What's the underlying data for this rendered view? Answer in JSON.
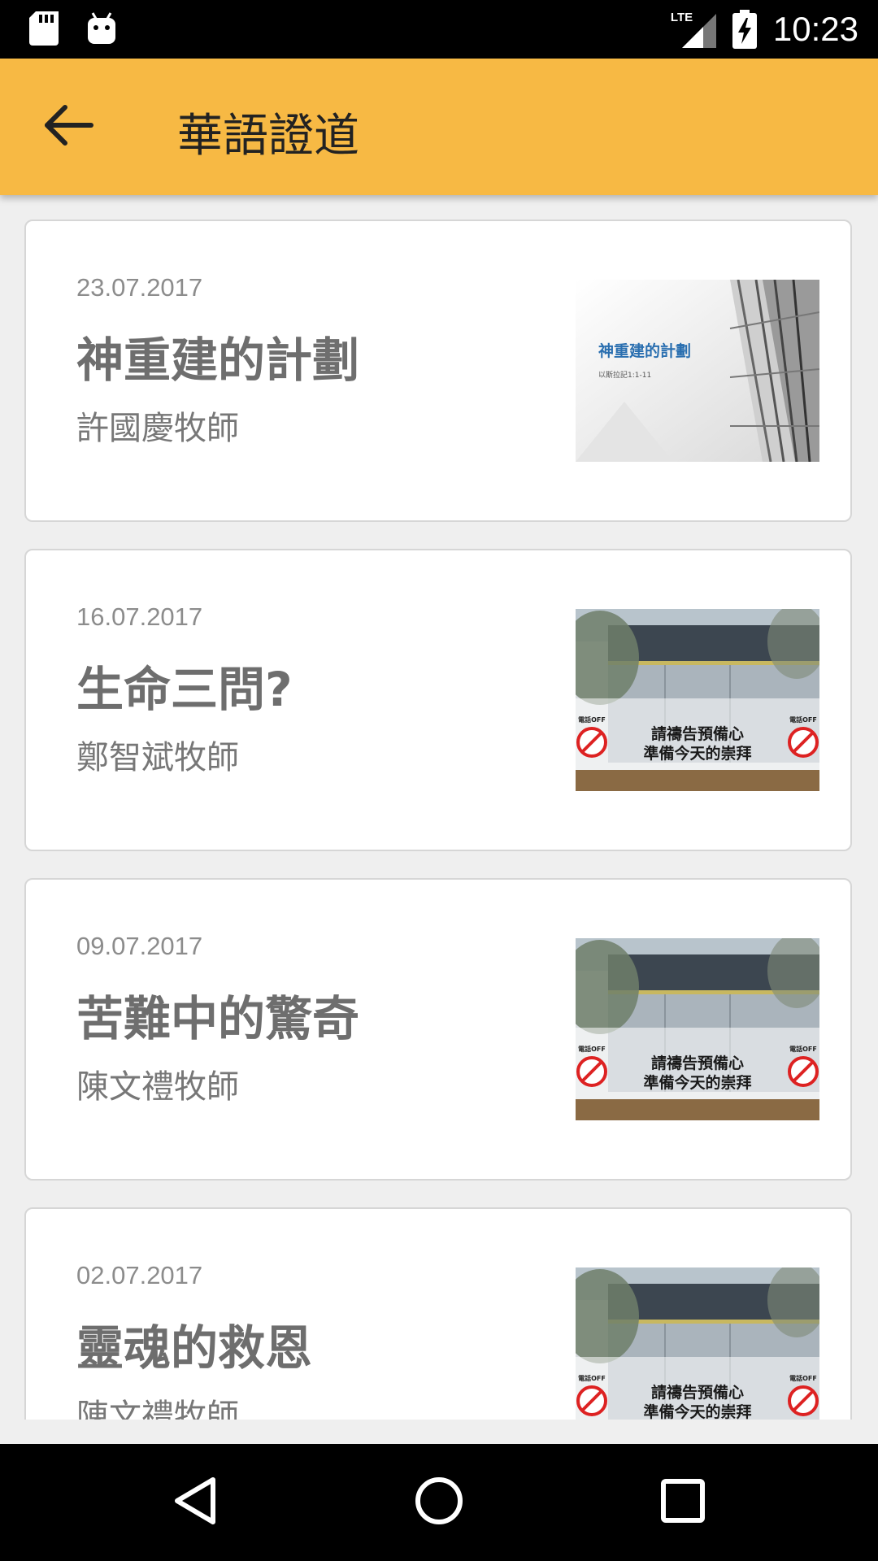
{
  "status_bar": {
    "time": "10:23",
    "network_label": "LTE",
    "icons": [
      "sd-card-icon",
      "android-icon",
      "lte-signal-icon",
      "battery-charging-icon"
    ]
  },
  "app_bar": {
    "title": "華語證道",
    "back_icon": "arrow-left-icon"
  },
  "sermons": [
    {
      "date": "23.07.2017",
      "title": "神重建的計劃",
      "speaker": "許國慶牧師",
      "thumbnail": {
        "style": "building-slide",
        "caption": "神重建的計劃",
        "sub": "以斯拉記1:1-11"
      }
    },
    {
      "date": "16.07.2017",
      "title": "生命三問?",
      "speaker": "鄭智斌牧師",
      "thumbnail": {
        "style": "church-sign",
        "line1": "請禱告預備心",
        "line2": "準備今天的崇拜",
        "side": "電話OFF"
      }
    },
    {
      "date": "09.07.2017",
      "title": "苦難中的驚奇",
      "speaker": "陳文禮牧師",
      "thumbnail": {
        "style": "church-sign",
        "line1": "請禱告預備心",
        "line2": "準備今天的崇拜",
        "side": "電話OFF"
      }
    },
    {
      "date": "02.07.2017",
      "title": "靈魂的救恩",
      "speaker": "陳文禮牧師",
      "thumbnail": {
        "style": "church-sign",
        "line1": "請禱告預備心",
        "line2": "準備今天的崇拜",
        "side": "電話OFF"
      }
    }
  ],
  "nav_bar": {
    "icons": [
      "nav-back-icon",
      "nav-home-icon",
      "nav-recents-icon"
    ]
  },
  "colors": {
    "app_bar": "#f7b944",
    "background": "#efefef",
    "card": "#ffffff",
    "status_bar": "#000000"
  }
}
